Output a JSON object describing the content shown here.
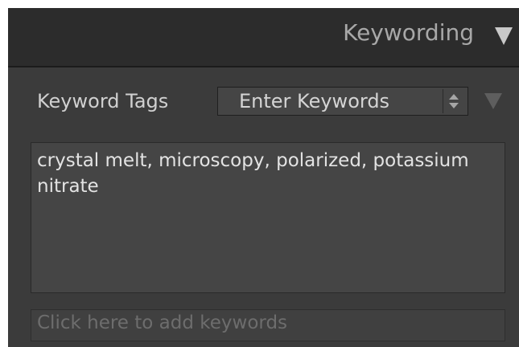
{
  "panel": {
    "title": "Keywording",
    "collapse_icon": "triangle-down-icon"
  },
  "keyword_tags": {
    "label": "Keyword Tags",
    "mode_selected": "Enter Keywords",
    "stepper_icon": "up-down-stepper-icon",
    "options_icon": "triangle-down-icon"
  },
  "keywords_text": "crystal melt, microscopy, polarized, potassium nitrate",
  "add_field": {
    "placeholder": "Click here to add keywords"
  }
}
